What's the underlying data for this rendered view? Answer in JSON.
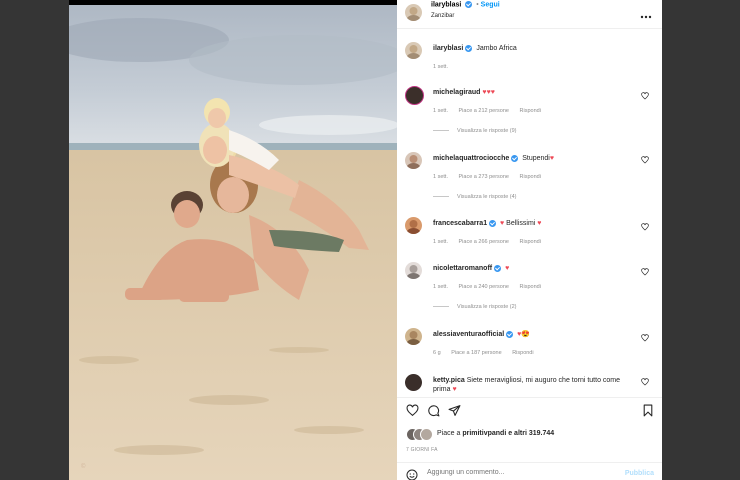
{
  "header": {
    "username": "ilaryblasi",
    "follow_label": "Segui",
    "location": "Zanzibar",
    "more_icon": "more-horizontal-icon"
  },
  "caption": {
    "username": "ilaryblasi",
    "text": "Jambo Africa",
    "time": "1 sett."
  },
  "comments": [
    {
      "username": "michelagiraud",
      "verified": false,
      "text": "♥♥♥",
      "time": "1 sett.",
      "likes": "Piace a 212 persone",
      "reply": "Rispondi",
      "replies": "Visualizza le risposte (9)"
    },
    {
      "username": "michelaquattrociocche",
      "verified": true,
      "text": "Stupendi",
      "heart": "♥",
      "time": "1 sett.",
      "likes": "Piace a 273 persone",
      "reply": "Rispondi",
      "replies": "Visualizza le risposte (4)"
    },
    {
      "username": "francescabarra1",
      "verified": true,
      "text": "Bellissimi",
      "heart_pre": "♥",
      "heart": "♥",
      "time": "1 sett.",
      "likes": "Piace a 266 persone",
      "reply": "Rispondi"
    },
    {
      "username": "nicolettaromanoff",
      "verified": true,
      "text": "",
      "heart": "♥",
      "time": "1 sett.",
      "likes": "Piace a 240 persone",
      "reply": "Rispondi",
      "replies": "Visualizza le risposte (2)"
    },
    {
      "username": "alessiaventuraofficial",
      "verified": true,
      "text": "",
      "heart": "♥",
      "emoji": "😍",
      "time": "6 g",
      "likes": "Piace a 187 persone",
      "reply": "Rispondi"
    },
    {
      "username": "ketty.pica",
      "verified": false,
      "text": "Siete meravigliosi, mi auguro che torni tutto come prima",
      "heart": "♥"
    }
  ],
  "actions": {
    "liked_by_prefix": "Piace a",
    "liked_by_user": "primitivpandi",
    "liked_by_suffix": "e altri 319.744",
    "date": "7 GIORNI FA",
    "comment_placeholder": "Aggiungi un commento...",
    "post_label": "Pubblica"
  },
  "colors": {
    "accent": "#0095f6",
    "heart": "#ed4956",
    "verified": "#3897f0"
  }
}
